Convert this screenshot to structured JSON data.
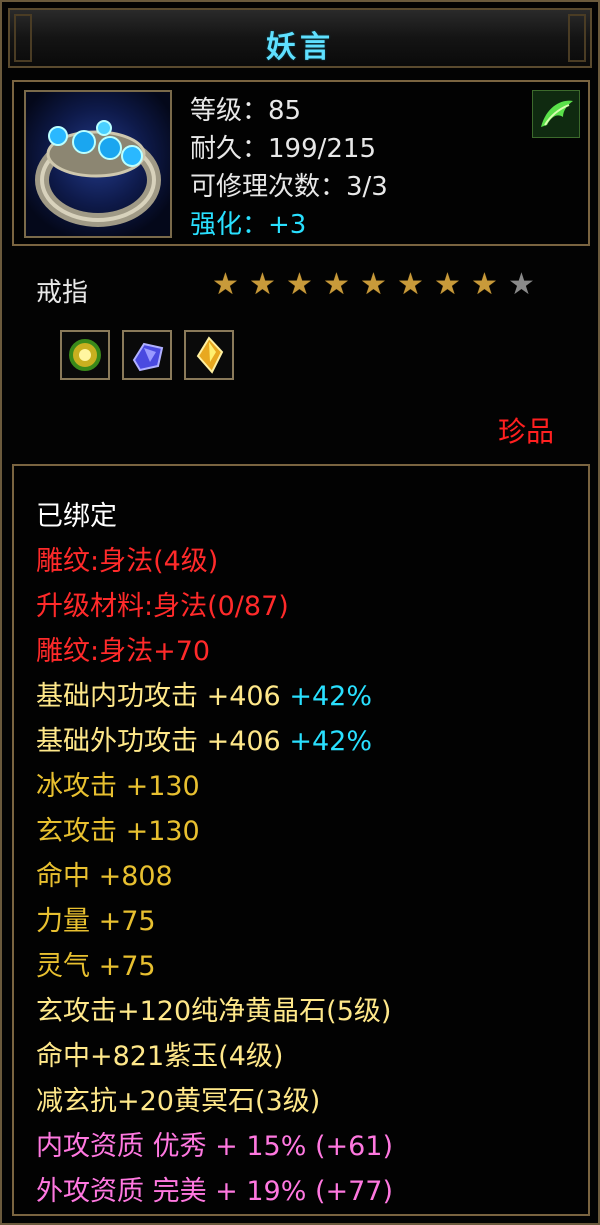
{
  "title": "妖言",
  "item": {
    "level_text": "等级：85",
    "durability_text": "耐久：199/215",
    "repair_text": "可修理次数：3/3",
    "enhance_text": "强化：+3",
    "type": "戒指",
    "stars_filled": 8,
    "stars_total": 9,
    "rarity": "珍品",
    "gem_slots": [
      "green-round-gem-icon",
      "blue-faceted-gem-icon",
      "yellow-crystal-gem-icon"
    ]
  },
  "stats": {
    "bound": "已绑定",
    "engrave": "雕纹:身法(4级)",
    "upgrade_mat": "升级材料:身法(0/87)",
    "engrave_bonus": "雕纹:身法+70",
    "base_inner": "基础内功攻击 +406",
    "base_inner_pct": "+42%",
    "base_outer": "基础外功攻击 +406",
    "base_outer_pct": "+42%",
    "ice_atk": "冰攻击 +130",
    "xuan_atk": "玄攻击 +130",
    "hit": "命中 +808",
    "strength": "力量 +75",
    "spirit": "灵气 +75",
    "gem1": "玄攻击+120纯净黄晶石(5级)",
    "gem2": "命中+821紫玉(4级)",
    "gem3": "减玄抗+20黄冥石(3级)",
    "inner_quality": "内攻资质 优秀 + 15% (+61)",
    "outer_quality": "外攻资质 完美 + 19% (+77)"
  },
  "colors": {
    "title": "#5fe0ff",
    "cyan": "#29e0ff",
    "red": "#ff2a2a",
    "yellow": "#ffe88a",
    "pink": "#ff78e0",
    "frame": "#7a6440"
  }
}
